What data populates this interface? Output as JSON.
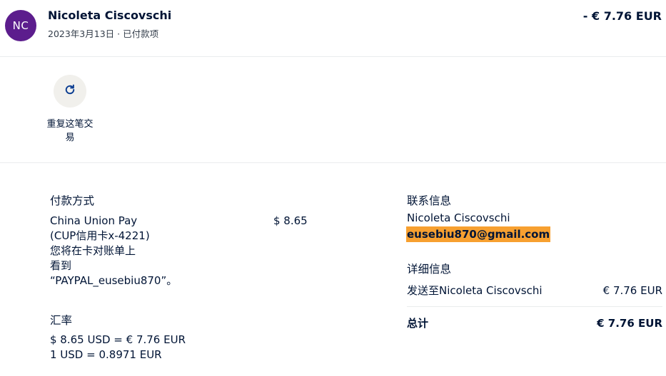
{
  "header": {
    "avatar_initials": "NC",
    "avatar_color": "#5c1d8d",
    "merchant_name": "Nicoleta Ciscovschi",
    "meta": "2023年3月13日 · 已付款项",
    "amount": "- € 7.76 EUR"
  },
  "actions": {
    "repeat_icon": "refresh-icon",
    "repeat_label": "重复这笔交易"
  },
  "payment_method": {
    "title": "付款方式",
    "description_lines": [
      "China Union Pay",
      "(CUP信用卡x-4221)",
      "您将在卡对账单上",
      "看到",
      "“PAYPAL_eusebiu870”。"
    ],
    "amount": "$ 8.65"
  },
  "exchange_rate": {
    "title": "汇率",
    "lines": [
      "$ 8.65 USD = € 7.76 EUR",
      "1 USD = 0.8971 EUR"
    ]
  },
  "contact": {
    "title": "联系信息",
    "name": "Nicoleta Ciscovschi",
    "email": "eusebiu870@gmail.com",
    "email_highlight_color": "#f7a030"
  },
  "details": {
    "title": "详细信息",
    "sent_to_label": "发送至Nicoleta Ciscovschi",
    "sent_to_amount": "€ 7.76 EUR",
    "total_label": "总计",
    "total_amount": "€ 7.76 EUR"
  }
}
